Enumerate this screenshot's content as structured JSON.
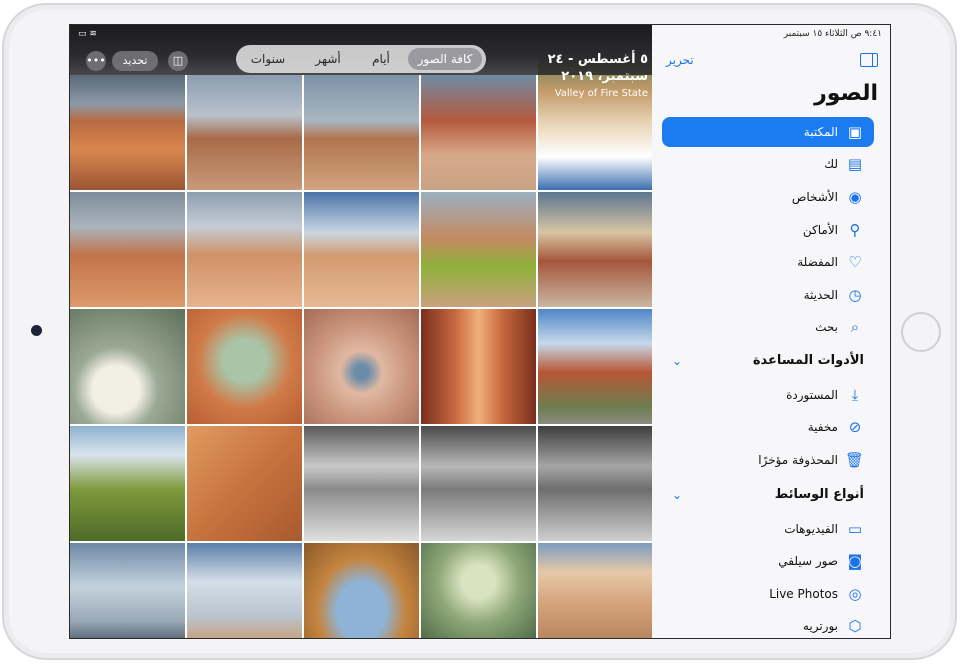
{
  "status": {
    "time": "٩:٤١ ص",
    "date": "الثلاثاء ١٥ سبتمبر",
    "battery": "100%"
  },
  "toolbar": {
    "more_icon": "ellipsis-icon",
    "select_label": "تحديد",
    "aspect_icon": "aspect-toggle-icon",
    "segments": [
      "سنوات",
      "أشهر",
      "أيام",
      "كافة الصور"
    ],
    "selected_segment": "كافة الصور"
  },
  "date_header": {
    "range": "٥ أغسطس - ٢٤ سبتمبر، ٢٠١٩",
    "place": "Valley of Fire State"
  },
  "sidebar": {
    "edit_label": "تحرير",
    "toggle_icon": "sidebar-icon",
    "title": "الصور",
    "items": [
      {
        "label": "المكتبة",
        "icon": "photo-library-icon",
        "selected": true
      },
      {
        "label": "لك",
        "icon": "for-you-icon",
        "selected": false
      },
      {
        "label": "الأشخاص",
        "icon": "person-circle-icon",
        "selected": false
      },
      {
        "label": "الأماكن",
        "icon": "map-pin-icon",
        "selected": false
      },
      {
        "label": "المفضلة",
        "icon": "heart-icon",
        "selected": false
      },
      {
        "label": "الحديثة",
        "icon": "clock-icon",
        "selected": false
      },
      {
        "label": "بحث",
        "icon": "search-icon",
        "selected": false
      }
    ],
    "utilities": {
      "title": "الأدوات المساعدة",
      "items": [
        {
          "label": "المستوردة",
          "icon": "import-icon"
        },
        {
          "label": "مخفية",
          "icon": "eye-slash-icon"
        },
        {
          "label": "المحذوفة مؤخرًا",
          "icon": "trash-icon"
        }
      ]
    },
    "media_types": {
      "title": "أنواع الوسائط",
      "items": [
        {
          "label": "الفيديوهات",
          "icon": "video-icon"
        },
        {
          "label": "صور سيلفي",
          "icon": "selfie-icon"
        },
        {
          "label": "Live Photos",
          "icon": "live-photo-icon"
        },
        {
          "label": "بورتريه",
          "icon": "cube-icon"
        }
      ]
    }
  },
  "colors": {
    "accent": "#1a7cf0",
    "sidebar_bg": "#f7f7f9"
  }
}
